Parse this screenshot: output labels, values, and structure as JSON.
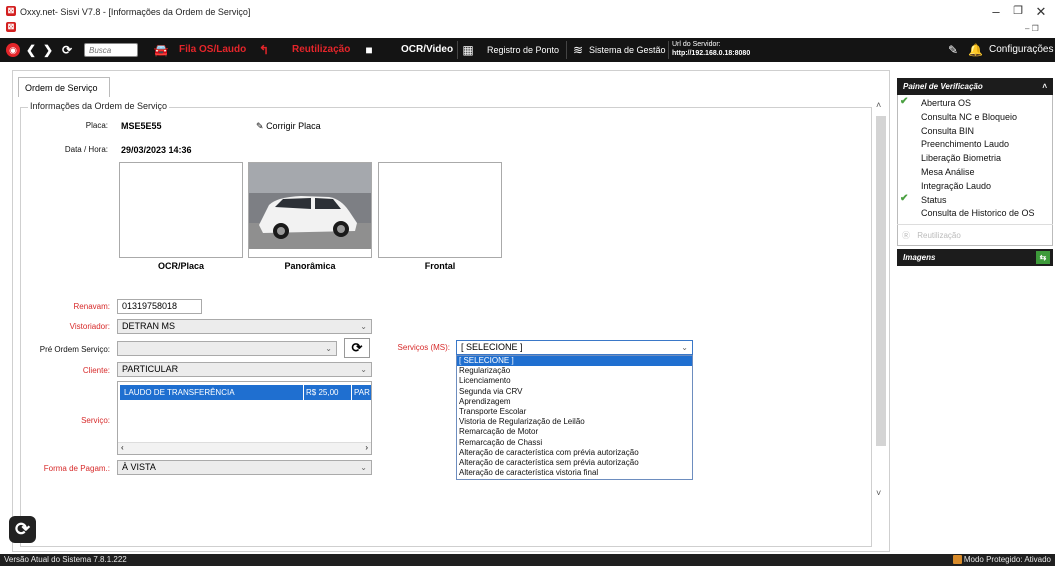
{
  "window": {
    "title": "Oxxy.net- Sisvi V7.8 - [Informações da Ordem de Serviço]"
  },
  "toolbar": {
    "search_placeholder": "Busca",
    "fila": "Fila OS/Laudo",
    "reutilizacao": "Reutilização",
    "ocr_video": "OCR/Video",
    "registro_ponto": "Registro de Ponto",
    "sistema_gestao": "Sistema de Gestão",
    "server_label": "Url do Servidor:",
    "server_url": "http://192.168.0.18:8080",
    "configuracoes": "Configurações"
  },
  "tab": {
    "label": "Ordem de Serviço"
  },
  "group": {
    "title": "Informações da Ordem de Serviço"
  },
  "form": {
    "placa_label": "Placa:",
    "placa_value": "MSE5E55",
    "corrigir_placa": "Corrigir Placa",
    "datahora_label": "Data / Hora:",
    "datahora_value": "29/03/2023  14:36",
    "photos": {
      "ocr": "OCR/Placa",
      "panoramica": "Panorâmica",
      "frontal": "Frontal"
    },
    "renavam_label": "Renavam:",
    "renavam_value": "01319758018",
    "vistoriador_label": "Vistoriador:",
    "vistoriador_value": "DETRAN MS",
    "pre_os_label": "Pré Ordem Serviço:",
    "pre_os_value": "",
    "cliente_label": "Cliente:",
    "cliente_value": "PARTICULAR",
    "servico_label": "Serviço:",
    "servico_row": {
      "name": "LAUDO DE TRANSFERÊNCIA",
      "price": "R$ 25,00",
      "extra": "PAR"
    },
    "forma_pag_label": "Forma de Pagam.:",
    "forma_pag_value": "À VISTA",
    "servicos_ms_label": "Serviços (MS):",
    "servicos_ms_value": "[ SELECIONE ]",
    "servicos_ms_options": [
      "[ SELECIONE ]",
      "Regularização",
      "Licenciamento",
      "Segunda via CRV",
      "Aprendizagem",
      "Transporte Escolar",
      "Vistoria de Regularização de Leilão",
      "Remarcação de Motor",
      "Remarcação de Chassi",
      "Alteração de característica com prévia autorização",
      "Alteração de característica sem prévia autorização",
      "Alteração de característica vistoria final"
    ]
  },
  "side_panel": {
    "title": "Painel de Verificação",
    "items": [
      {
        "label": "Abertura OS",
        "checked": true
      },
      {
        "label": "Consulta NC e Bloqueio",
        "checked": false
      },
      {
        "label": "Consulta BIN",
        "checked": false
      },
      {
        "label": "Preenchimento Laudo",
        "checked": false
      },
      {
        "label": "Liberação Biometria",
        "checked": false
      },
      {
        "label": "Mesa Análise",
        "checked": false
      },
      {
        "label": "Integração Laudo",
        "checked": false
      },
      {
        "label": "Status",
        "checked": true
      },
      {
        "label": "Consulta de Historico de OS",
        "checked": false
      }
    ],
    "reutilizacao": "Reutilização",
    "imagens_title": "Imagens"
  },
  "statusbar": {
    "version": "Versão Atual do Sistema 7.8.1.222",
    "protected": "Modo Protegido: Ativado"
  }
}
